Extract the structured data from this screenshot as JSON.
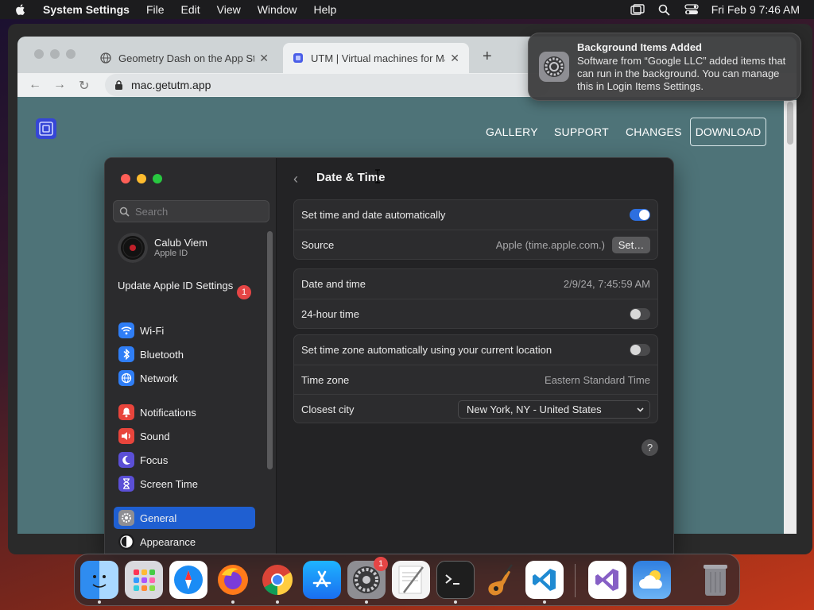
{
  "menubar": {
    "app_name": "System Settings",
    "menus": [
      "File",
      "Edit",
      "View",
      "Window",
      "Help"
    ],
    "clock": "Fri Feb 9  7:46 AM"
  },
  "browser": {
    "tabs": [
      {
        "title": "Geometry Dash on the App Sto"
      },
      {
        "title": "UTM | Virtual machines for Mac"
      }
    ],
    "url": "mac.getutm.app",
    "site_nav": [
      "GALLERY",
      "SUPPORT",
      "CHANGES"
    ],
    "download_label": "DOWNLOAD"
  },
  "notification": {
    "title": "Background Items Added",
    "body": "Software from “Google LLC” added items that can run in the background. You can manage this in Login Items Settings."
  },
  "settings": {
    "sidebar": {
      "search_placeholder": "Search",
      "user_name": "Calub Viem",
      "user_sub": "Apple ID",
      "update_text": "Update Apple ID Settings",
      "update_badge": "1",
      "items": [
        {
          "label": "Wi-Fi",
          "icon": "wifi-icon",
          "color": "#2f7ef6"
        },
        {
          "label": "Bluetooth",
          "icon": "bluetooth-icon",
          "color": "#2f7ef6"
        },
        {
          "label": "Network",
          "icon": "globe-icon",
          "color": "#2f7ef6"
        },
        {
          "label": "Notifications",
          "icon": "bell-icon",
          "color": "#e8453c"
        },
        {
          "label": "Sound",
          "icon": "speaker-icon",
          "color": "#e8453c"
        },
        {
          "label": "Focus",
          "icon": "moon-icon",
          "color": "#5b4fd6"
        },
        {
          "label": "Screen Time",
          "icon": "hourglass-icon",
          "color": "#5b4fd6"
        },
        {
          "label": "General",
          "icon": "gear-icon",
          "color": "#8e8e93"
        },
        {
          "label": "Appearance",
          "icon": "appearance-icon",
          "color": "#1c1c1e"
        }
      ],
      "selected": "General"
    },
    "page_title": "Date & Time",
    "rows": {
      "auto_time_label": "Set time and date automatically",
      "auto_time_on": true,
      "source_label": "Source",
      "source_value": "Apple (time.apple.com.)",
      "set_button": "Set…",
      "date_time_label": "Date and time",
      "date_time_value": "2/9/24, 7:45:59 AM",
      "hour24_label": "24-hour time",
      "hour24_on": false,
      "auto_tz_label": "Set time zone automatically using your current location",
      "auto_tz_on": false,
      "tz_label": "Time zone",
      "tz_value": "Eastern Standard Time",
      "city_label": "Closest city",
      "city_value": "New York, NY - United States"
    },
    "help_label": "?"
  },
  "dock": {
    "apps": [
      "Finder",
      "Launchpad",
      "Safari",
      "Firefox",
      "Chrome",
      "App Store",
      "System Settings",
      "TextEdit",
      "Terminal",
      "GarageBand",
      "Visual Studio Code",
      "Visual Studio",
      "Weather",
      "Trash"
    ],
    "settings_badge": "1"
  }
}
